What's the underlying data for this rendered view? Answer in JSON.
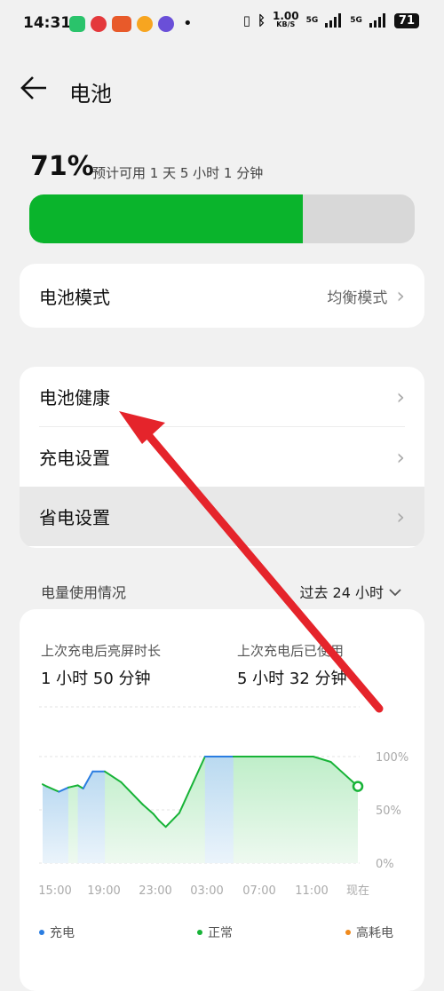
{
  "status_bar": {
    "time": "14:31",
    "net_speed": "1.00",
    "net_unit": "KB/S",
    "sim1": "5G",
    "sim2": "5G",
    "battery": "71"
  },
  "header": {
    "title": "电池",
    "back_icon": "arrow-left-icon"
  },
  "battery": {
    "percent_label": "71%",
    "level": 71,
    "estimate": "预计可用 1 天 5 小时 1 分钟",
    "fill_color": "#0ab42c"
  },
  "mode_card": {
    "label": "电池模式",
    "value": "均衡模式"
  },
  "settings": [
    {
      "label": "电池健康"
    },
    {
      "label": "充电设置"
    },
    {
      "label": "省电设置"
    }
  ],
  "usage": {
    "section_label": "电量使用情况",
    "range_label": "过去 24 小时",
    "screen_on_label": "上次充电后亮屏时长",
    "screen_on_value": "1 小时 50 分钟",
    "used_label": "上次充电后已使用",
    "used_value": "5 小时 32 分钟"
  },
  "chart_data": {
    "type": "area",
    "x_ticks": [
      "15:00",
      "19:00",
      "23:00",
      "03:00",
      "07:00",
      "11:00",
      "现在"
    ],
    "y_ticks": [
      "100%",
      "50%",
      "0%"
    ],
    "ylim": [
      0,
      100
    ],
    "series": [
      {
        "name": "充电",
        "color": "#2a7de1"
      },
      {
        "name": "正常",
        "color": "#17b337"
      },
      {
        "name": "高耗电",
        "color": "#f08a1c"
      }
    ],
    "x_hours": [
      0,
      0.3,
      1.2,
      1.9,
      2.6,
      3.0,
      3.7,
      4.6,
      5.8,
      7.4,
      8.2,
      8.6,
      9.1,
      10.1,
      12.0,
      14.1,
      15.5,
      16.7,
      18.3,
      20.0,
      21.3,
      23.3
    ],
    "values": [
      74,
      72,
      67,
      71,
      73,
      70,
      86,
      86,
      76,
      55,
      46,
      40,
      34,
      47,
      100,
      100,
      100,
      100,
      100,
      100,
      95,
      72
    ],
    "charging_ranges": [
      [
        0,
        1.9
      ],
      [
        2.6,
        4.6
      ],
      [
        12.0,
        14.1
      ]
    ]
  },
  "annotation": {
    "color": "#e5242b"
  }
}
